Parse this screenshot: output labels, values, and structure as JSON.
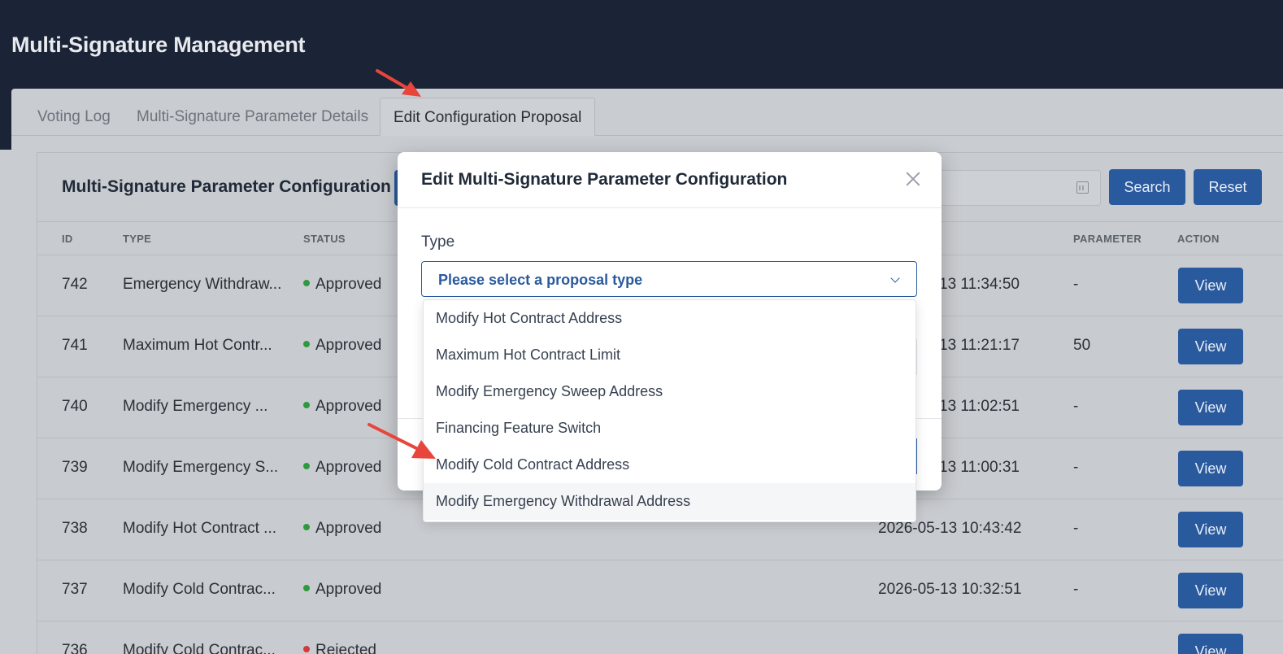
{
  "app": {
    "title": "Multi-Signature Management"
  },
  "tabs": [
    {
      "label": "Voting Log"
    },
    {
      "label": "Multi-Signature Parameter Details"
    },
    {
      "label": "Edit Configuration Proposal"
    }
  ],
  "card": {
    "title": "Multi-Signature Parameter Configuration",
    "search_label": "Search",
    "reset_label": "Reset"
  },
  "table": {
    "headers": {
      "id": "ID",
      "type": "TYPE",
      "status": "STATUS",
      "parameter": "PARAMETER",
      "action": "ACTION"
    },
    "rows": [
      {
        "id": "742",
        "type": "Emergency Withdraw...",
        "status": "Approved",
        "time": "13 11:34:50",
        "parameter": "-",
        "action": "View"
      },
      {
        "id": "741",
        "type": "Maximum Hot Contr...",
        "status": "Approved",
        "time": "13 11:21:17",
        "parameter": "50",
        "action": "View"
      },
      {
        "id": "740",
        "type": "Modify Emergency ...",
        "status": "Approved",
        "time": "13 11:02:51",
        "parameter": "-",
        "action": "View"
      },
      {
        "id": "739",
        "type": "Modify Emergency S...",
        "status": "Approved",
        "time": "13 11:00:31",
        "parameter": "-",
        "action": "View"
      },
      {
        "id": "738",
        "type": "Modify Hot Contract ...",
        "status": "Approved",
        "time": "2026-05-13 10:43:42",
        "parameter": "-",
        "action": "View"
      },
      {
        "id": "737",
        "type": "Modify Cold Contrac...",
        "status": "Approved",
        "time": "2026-05-13 10:32:51",
        "parameter": "-",
        "action": "View"
      },
      {
        "id": "736",
        "type": "Modify Cold Contrac...",
        "status": "Rejected",
        "time": "",
        "parameter": "",
        "action": "View"
      }
    ]
  },
  "modal": {
    "title": "Edit Multi-Signature Parameter Configuration",
    "type_label": "Type",
    "select_placeholder": "Please select a proposal type",
    "options": [
      "Modify Hot Contract Address",
      "Maximum Hot Contract Limit",
      "Modify Emergency Sweep Address",
      "Financing Feature Switch",
      "Modify Cold Contract Address",
      "Modify Emergency Withdrawal Address"
    ]
  },
  "colors": {
    "primary": "#2a5a9e",
    "header_bg": "#1a2436",
    "approved": "#2e9a3e",
    "rejected": "#d13a3a",
    "annotation": "#e8453c"
  }
}
